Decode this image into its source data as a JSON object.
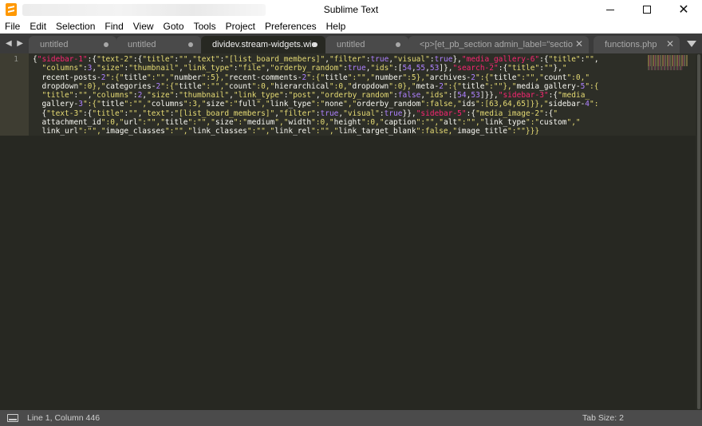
{
  "window": {
    "title": "Sublime Text",
    "minimize_icon": "minimize-icon",
    "maximize_icon": "maximize-icon",
    "close_glyph": "✕"
  },
  "menu": [
    "File",
    "Edit",
    "Selection",
    "Find",
    "View",
    "Goto",
    "Tools",
    "Project",
    "Preferences",
    "Help"
  ],
  "tabs": [
    {
      "label": "untitled",
      "active": false,
      "indicator": "dot"
    },
    {
      "label": "untitled",
      "active": false,
      "indicator": "dot"
    },
    {
      "label": "dividev.stream-widgets.wie",
      "active": true,
      "indicator": "dot"
    },
    {
      "label": "untitled",
      "active": false,
      "indicator": "dot"
    },
    {
      "label": "<p>[et_pb_section admin_label=\"section\"]<br>",
      "active": false,
      "indicator": "close"
    },
    {
      "label": "functions.php",
      "active": false,
      "indicator": "close"
    }
  ],
  "tab_nav": {
    "left": "◀",
    "right": "▶"
  },
  "editor": {
    "line_number": "1",
    "code_lines": [
      "{\"sidebar-1\":{\"text-2\":{\"title\":\"\",\"text\":\"[list_board_members]\",\"filter\":true,\"visual\":true},\"media_gallery-6\":{\"title\":\"\",",
      "  \"columns\":3,\"size\":\"thumbnail\",\"link_type\":\"file\",\"orderby_random\":true,\"ids\":[54,55,53]},\"search-2\":{\"title\":\"\"},\"",
      "  recent-posts-2\":{\"title\":\"\",\"number\":5},\"recent-comments-2\":{\"title\":\"\",\"number\":5},\"archives-2\":{\"title\":\"\",\"count\":0,\"",
      "  dropdown\":0},\"categories-2\":{\"title\":\"\",\"count\":0,\"hierarchical\":0,\"dropdown\":0},\"meta-2\":{\"title\":\"\"},\"media_gallery-5\":{",
      "  \"title\":\"\",\"columns\":2,\"size\":\"thumbnail\",\"link_type\":\"post\",\"orderby_random\":false,\"ids\":[54,53]}},\"sidebar-3\":{\"media_",
      "  gallery-3\":{\"title\":\"\",\"columns\":3,\"size\":\"full\",\"link_type\":\"none\",\"orderby_random\":false,\"ids\":[63,64,65]}},\"sidebar-4\":",
      "  {\"text-3\":{\"title\":\"\",\"text\":\"[list_board_members]\",\"filter\":true,\"visual\":true}},\"sidebar-5\":{\"media_image-2\":{\"",
      "  attachment_id\":0,\"url\":\"\",\"title\":\"\",\"size\":\"medium\",\"width\":0,\"height\":0,\"caption\":\"\",\"alt\":\"\",\"link_type\":\"custom\",\"",
      "  link_url\":\"\",\"image_classes\":\"\",\"link_classes\":\"\",\"link_rel\":\"\",\"link_target_blank\":false,\"image_title\":\"\"}}}"
    ]
  },
  "status": {
    "position": "Line 1, Column 446",
    "tab_size": "Tab Size: 2"
  },
  "colors": {
    "editor_bg": "#272822",
    "string": "#e6db74",
    "key_pink": "#f92672",
    "number": "#ae81ff",
    "text": "#f8f8f2"
  }
}
